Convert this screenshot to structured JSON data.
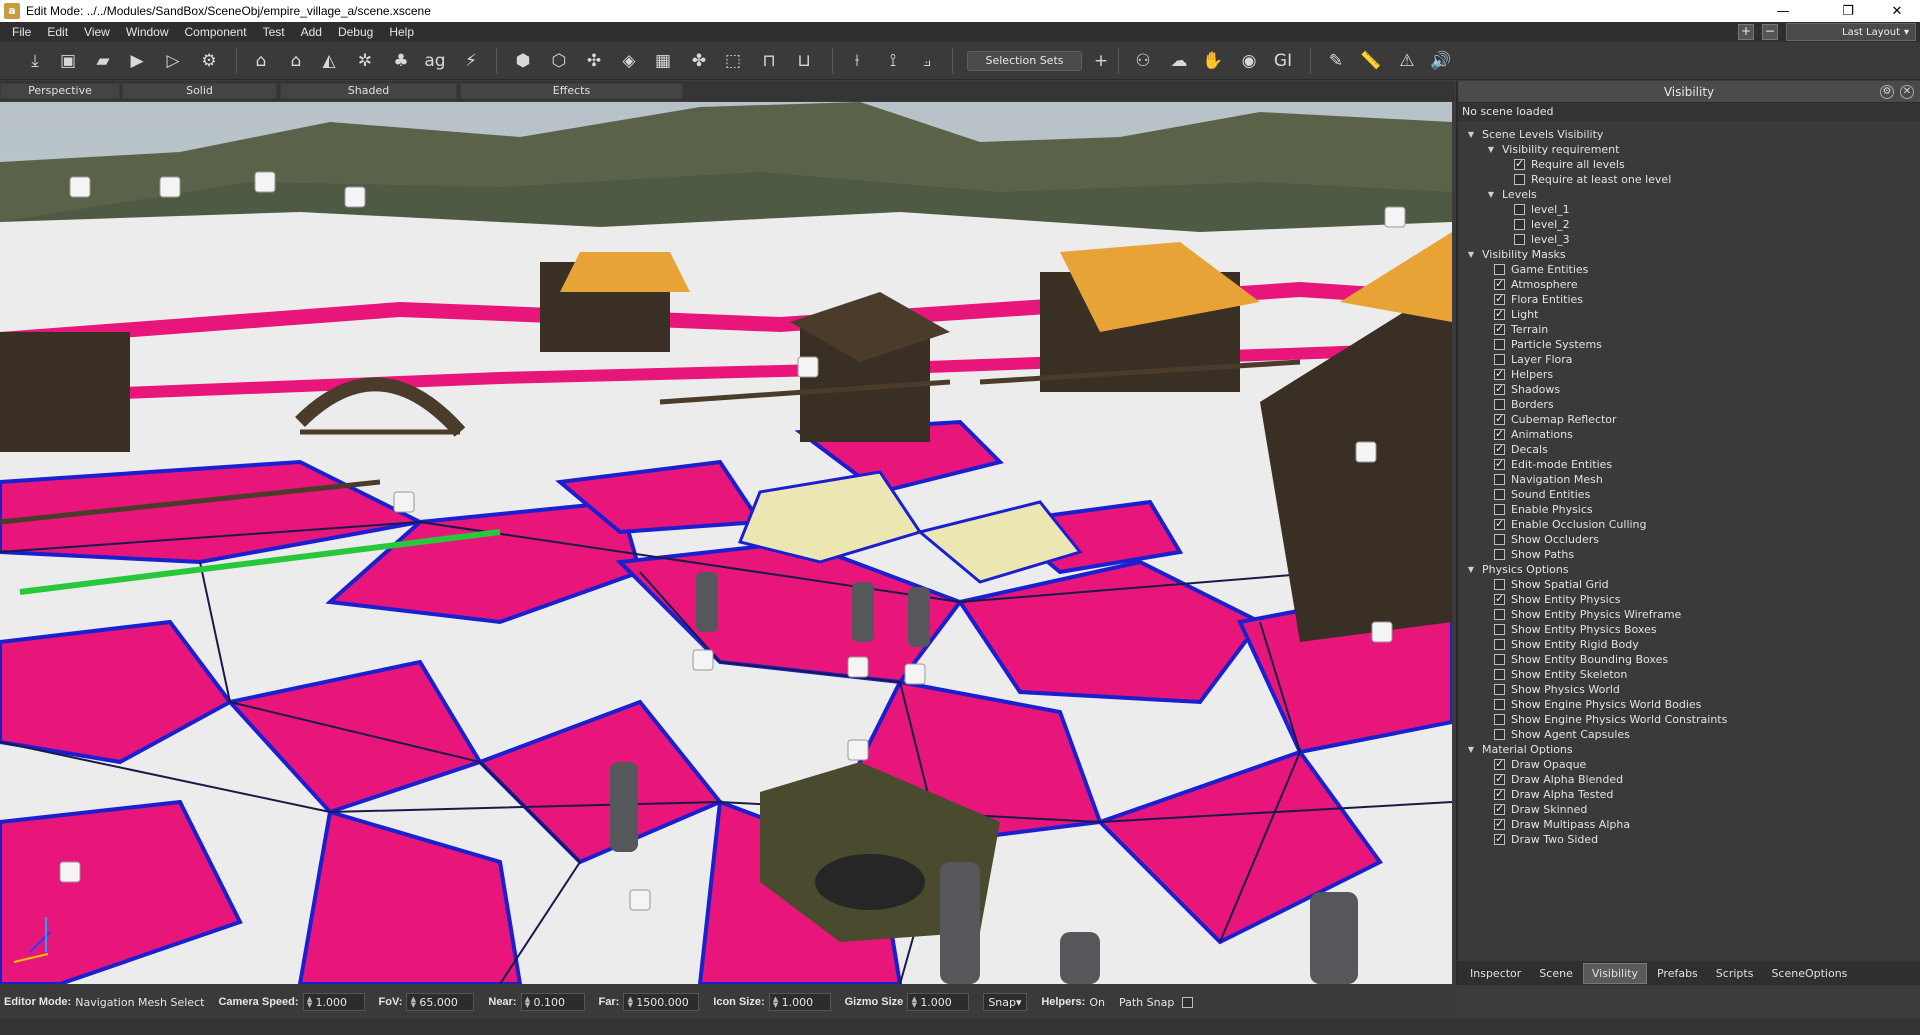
{
  "window": {
    "title": "Edit Mode: ../../Modules/SandBox/SceneObj/empire_village_a/scene.xscene",
    "controls": [
      "minimize",
      "maximize",
      "close"
    ]
  },
  "menu": [
    "File",
    "Edit",
    "View",
    "Window",
    "Component",
    "Test",
    "Add",
    "Debug",
    "Help"
  ],
  "layout": {
    "selected": "Last Layout"
  },
  "toolbar": {
    "selection_sets_label": "Selection Sets"
  },
  "view_tabs": [
    "Perspective",
    "Solid",
    "Shaded",
    "Effects"
  ],
  "panel": {
    "title": "Visibility",
    "status": "No scene loaded",
    "tree": [
      {
        "label": "Scene Levels Visibility",
        "depth": 0,
        "type": "group"
      },
      {
        "label": "Visibility requirement",
        "depth": 1,
        "type": "group"
      },
      {
        "label": "Require all levels",
        "depth": 2,
        "type": "check",
        "checked": true
      },
      {
        "label": "Require at least one level",
        "depth": 2,
        "type": "check",
        "checked": false
      },
      {
        "label": "Levels",
        "depth": 1,
        "type": "group"
      },
      {
        "label": "level_1",
        "depth": 2,
        "type": "check",
        "checked": false
      },
      {
        "label": "level_2",
        "depth": 2,
        "type": "check",
        "checked": false
      },
      {
        "label": "level_3",
        "depth": 2,
        "type": "check",
        "checked": false
      },
      {
        "label": "Visibility Masks",
        "depth": 0,
        "type": "group"
      },
      {
        "label": "Game Entities",
        "depth": 1,
        "type": "check",
        "checked": false
      },
      {
        "label": "Atmosphere",
        "depth": 1,
        "type": "check",
        "checked": true
      },
      {
        "label": "Flora Entities",
        "depth": 1,
        "type": "check",
        "checked": true
      },
      {
        "label": "Light",
        "depth": 1,
        "type": "check",
        "checked": true
      },
      {
        "label": "Terrain",
        "depth": 1,
        "type": "check",
        "checked": true
      },
      {
        "label": "Particle Systems",
        "depth": 1,
        "type": "check",
        "checked": false
      },
      {
        "label": "Layer Flora",
        "depth": 1,
        "type": "check",
        "checked": false
      },
      {
        "label": "Helpers",
        "depth": 1,
        "type": "check",
        "checked": true
      },
      {
        "label": "Shadows",
        "depth": 1,
        "type": "check",
        "checked": true
      },
      {
        "label": "Borders",
        "depth": 1,
        "type": "check",
        "checked": false
      },
      {
        "label": "Cubemap Reflector",
        "depth": 1,
        "type": "check",
        "checked": true
      },
      {
        "label": "Animations",
        "depth": 1,
        "type": "check",
        "checked": true
      },
      {
        "label": "Decals",
        "depth": 1,
        "type": "check",
        "checked": true
      },
      {
        "label": "Edit-mode Entities",
        "depth": 1,
        "type": "check",
        "checked": true
      },
      {
        "label": "Navigation Mesh",
        "depth": 1,
        "type": "check",
        "checked": false
      },
      {
        "label": "Sound Entities",
        "depth": 1,
        "type": "check",
        "checked": false
      },
      {
        "label": "Enable Physics",
        "depth": 1,
        "type": "check",
        "checked": false
      },
      {
        "label": "Enable Occlusion Culling",
        "depth": 1,
        "type": "check",
        "checked": true
      },
      {
        "label": "Show Occluders",
        "depth": 1,
        "type": "check",
        "checked": false
      },
      {
        "label": "Show Paths",
        "depth": 1,
        "type": "check",
        "checked": false
      },
      {
        "label": "Physics Options",
        "depth": 0,
        "type": "group"
      },
      {
        "label": "Show Spatial Grid",
        "depth": 1,
        "type": "check",
        "checked": false
      },
      {
        "label": "Show Entity Physics",
        "depth": 1,
        "type": "check",
        "checked": true
      },
      {
        "label": "Show Entity Physics Wireframe",
        "depth": 1,
        "type": "check",
        "checked": false
      },
      {
        "label": "Show Entity Physics Boxes",
        "depth": 1,
        "type": "check",
        "checked": false
      },
      {
        "label": "Show Entity Rigid Body",
        "depth": 1,
        "type": "check",
        "checked": false
      },
      {
        "label": "Show Entity Bounding Boxes",
        "depth": 1,
        "type": "check",
        "checked": false
      },
      {
        "label": "Show Entity Skeleton",
        "depth": 1,
        "type": "check",
        "checked": false
      },
      {
        "label": "Show Physics World",
        "depth": 1,
        "type": "check",
        "checked": false
      },
      {
        "label": "Show Engine Physics World Bodies",
        "depth": 1,
        "type": "check",
        "checked": false
      },
      {
        "label": "Show Engine Physics World Constraints",
        "depth": 1,
        "type": "check",
        "checked": false
      },
      {
        "label": "Show Agent Capsules",
        "depth": 1,
        "type": "check",
        "checked": false
      },
      {
        "label": "Material Options",
        "depth": 0,
        "type": "group"
      },
      {
        "label": "Draw Opaque",
        "depth": 1,
        "type": "check",
        "checked": true
      },
      {
        "label": "Draw Alpha Blended",
        "depth": 1,
        "type": "check",
        "checked": true
      },
      {
        "label": "Draw Alpha Tested",
        "depth": 1,
        "type": "check",
        "checked": true
      },
      {
        "label": "Draw Skinned",
        "depth": 1,
        "type": "check",
        "checked": true
      },
      {
        "label": "Draw Multipass Alpha",
        "depth": 1,
        "type": "check",
        "checked": true
      },
      {
        "label": "Draw Two Sided",
        "depth": 1,
        "type": "check",
        "checked": true
      }
    ],
    "tabs": [
      {
        "label": "Inspector",
        "active": false
      },
      {
        "label": "Scene",
        "active": false
      },
      {
        "label": "Visibility",
        "active": true
      },
      {
        "label": "Prefabs",
        "active": false
      },
      {
        "label": "Scripts",
        "active": false
      },
      {
        "label": "SceneOptions",
        "active": false
      }
    ]
  },
  "status": {
    "editor_mode_label": "Editor Mode:",
    "editor_mode_value": "Navigation Mesh Select",
    "camera_speed_label": "Camera Speed:",
    "camera_speed": "1.000",
    "fov_label": "FoV:",
    "fov": "65.000",
    "near_label": "Near:",
    "near": "0.100",
    "far_label": "Far:",
    "far": "1500.000",
    "icon_size_label": "Icon Size:",
    "icon_size": "1.000",
    "gizmo_size_label": "Gizmo Size",
    "gizmo_size": "1.000",
    "snap": "Snap",
    "helpers_label": "Helpers:",
    "helpers_value": "On",
    "path_snap_label": "Path Snap",
    "path_snap_checked": false
  },
  "colors": {
    "navmesh_pink": "#e8157a",
    "navmesh_white": "#ececec",
    "navmesh_yellow": "#ece7b2",
    "edge_blue": "#1a1fd0",
    "mountain": "#5a6249"
  }
}
